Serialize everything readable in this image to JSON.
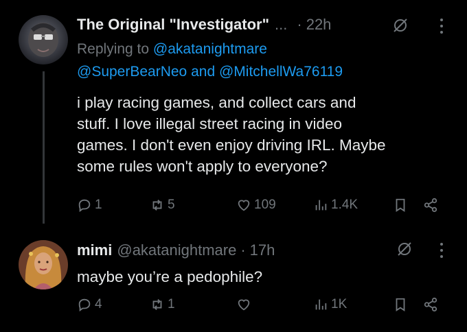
{
  "tweets": [
    {
      "display_name": "The Original \"Investigator\"",
      "ellipsis": "...",
      "time": "22h",
      "replying_prefix": "Replying to",
      "replying_to_1": "@akatanightmare",
      "replying_to_2": "@SuperBearNeo",
      "replying_and": "and",
      "replying_to_3": "@MitchellWa76119",
      "text_lines": [
        "i play racing games, and collect cars and",
        "stuff. I love illegal street racing in video",
        "games. I don't even enjoy driving IRL. Maybe",
        "some rules won't apply to everyone?"
      ],
      "replies": "1",
      "reposts": "5",
      "likes": "109",
      "views": "1.4K",
      "avatar_icon": "avatar-icon"
    },
    {
      "display_name": "mimi",
      "handle": "@akatanightmare",
      "time": "17h",
      "text_lines": [
        "maybe you’re a pedophile?"
      ],
      "replies": "4",
      "reposts": "1",
      "likes": "",
      "views": "1K",
      "avatar_icon": "avatar-icon"
    }
  ],
  "colors": {
    "background": "#000000",
    "text": "#e7e9ea",
    "muted": "#71767b",
    "link": "#1d9bf0"
  },
  "icons": [
    "reply-icon",
    "repost-icon",
    "like-icon",
    "views-icon",
    "bookmark-icon",
    "share-icon",
    "grok-icon",
    "more-icon"
  ]
}
